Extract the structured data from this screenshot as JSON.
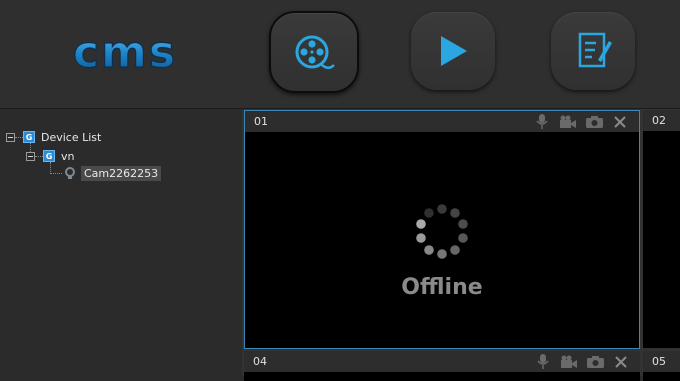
{
  "app": {
    "logo_text": "cms"
  },
  "toolbar": {
    "buttons": [
      {
        "name": "monitor",
        "icon": "film-reel-icon",
        "active": true
      },
      {
        "name": "playback",
        "icon": "play-icon",
        "active": false
      },
      {
        "name": "log",
        "icon": "edit-document-icon",
        "active": false
      }
    ]
  },
  "tree": {
    "root": {
      "label": "Device List",
      "icon_text": "G"
    },
    "group": {
      "label": "vn",
      "icon_text": "G"
    },
    "camera": {
      "label": "Cam2262253"
    }
  },
  "panes": [
    {
      "number": "01",
      "status": "Offline"
    },
    {
      "number": "02"
    },
    {
      "number": "04"
    },
    {
      "number": "05"
    }
  ],
  "colors": {
    "accent": "#2aa7e0",
    "selected_border": "#3b86b5"
  }
}
